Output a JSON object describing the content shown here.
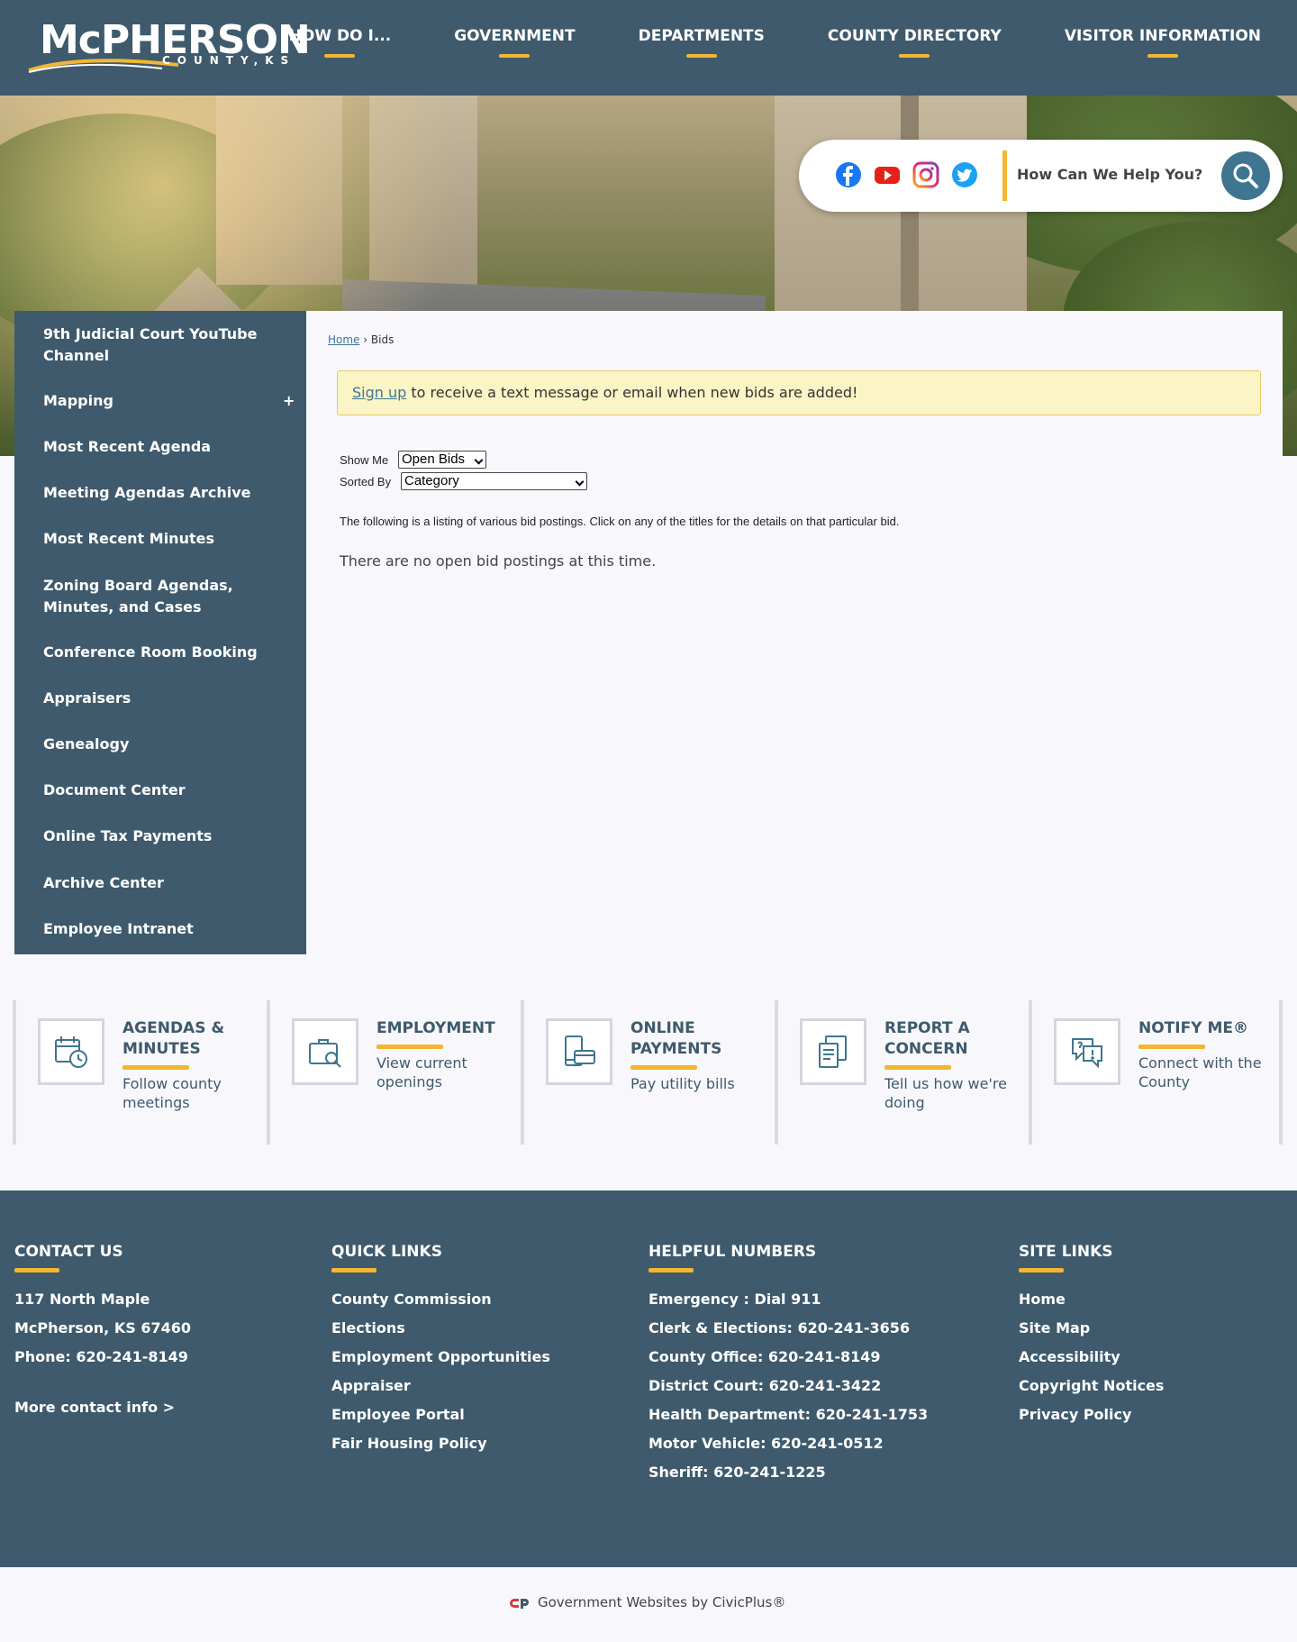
{
  "header": {
    "logo_main": "McPHERSON",
    "logo_sub": "COUNTY,KS",
    "nav": [
      "HOW DO I...",
      "GOVERNMENT",
      "DEPARTMENTS",
      "COUNTY DIRECTORY",
      "VISITOR INFORMATION"
    ]
  },
  "utility": {
    "social": [
      "facebook-icon",
      "youtube-icon",
      "instagram-icon",
      "twitter-icon"
    ],
    "search_placeholder": "How Can We Help You?"
  },
  "sidebar": {
    "items": [
      "9th Judicial Court YouTube Channel",
      "Mapping",
      "Most Recent Agenda",
      "Meeting Agendas Archive",
      "Most Recent Minutes",
      "Zoning Board Agendas, Minutes, and Cases",
      "Conference Room Booking",
      "Appraisers",
      "Genealogy",
      "Document Center",
      "Online Tax Payments",
      "Archive Center",
      "Employee Intranet"
    ],
    "expand_symbol": "+"
  },
  "main": {
    "breadcrumb_home": "Home",
    "breadcrumb_sep": "›",
    "breadcrumb_current": "Bids",
    "alert_link": "Sign up",
    "alert_text": " to receive a text message or email when new bids are added!",
    "show_me_label": "Show Me",
    "show_me_value": "Open Bids",
    "sorted_by_label": "Sorted By",
    "sorted_by_value": "Category",
    "listing_note": "The following is a listing of various bid postings. Click on any of the titles for the details on that particular bid.",
    "empty_message": "There are no open bid postings at this time."
  },
  "tiles": [
    {
      "title": "AGENDAS & MINUTES",
      "desc": "Follow county meetings",
      "icon": "calendar-clock-icon"
    },
    {
      "title": "EMPLOYMENT",
      "desc": "View current openings",
      "icon": "briefcase-search-icon"
    },
    {
      "title": "ONLINE PAYMENTS",
      "desc": "Pay utility bills",
      "icon": "payment-device-icon"
    },
    {
      "title": "REPORT A CONCERN",
      "desc": "Tell us how we're doing",
      "icon": "document-report-icon"
    },
    {
      "title": "NOTIFY ME®",
      "desc": "Connect with the County",
      "icon": "chat-alert-icon"
    }
  ],
  "footer": {
    "contact": {
      "heading": "CONTACT US",
      "lines": [
        "117 North Maple",
        "McPherson, KS 67460",
        "Phone: 620-241-8149"
      ],
      "more": "More contact info >"
    },
    "quick_links": {
      "heading": "QUICK LINKS",
      "links": [
        "County Commission",
        "Elections",
        "Employment Opportunities",
        "Appraiser",
        "Employee Portal",
        "Fair Housing Policy"
      ]
    },
    "helpful_numbers": {
      "heading": "HELPFUL NUMBERS",
      "lines": [
        "Emergency : Dial 911",
        "Clerk & Elections: 620-241-3656",
        "County Office: 620-241-8149",
        "District Court: 620-241-3422",
        "Health Department: 620-241-1753",
        "Motor Vehicle: 620-241-0512",
        "Sheriff: 620-241-1225"
      ]
    },
    "site_links": {
      "heading": "SITE LINKS",
      "links": [
        "Home",
        "Site Map",
        "Accessibility",
        "Copyright Notices",
        "Privacy Policy"
      ]
    }
  },
  "bottom": {
    "powered_by": "Government Websites by CivicPlus®"
  },
  "colors": {
    "brand_slate": "#3e5a6c",
    "accent_gold": "#f2b632",
    "search_button": "#3e7590",
    "alert_bg": "#fbf4c5"
  }
}
